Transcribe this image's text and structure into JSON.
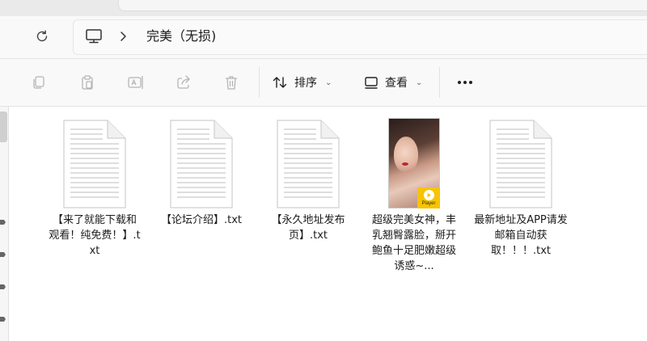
{
  "window": {
    "breadcrumb": {
      "root_icon": "this-pc-icon",
      "separator_icon": "chevron-right-icon",
      "current": "完美（无损)"
    }
  },
  "toolbar": {
    "icons": [
      "copy-icon",
      "paste-icon",
      "rename-icon",
      "share-icon",
      "delete-icon"
    ],
    "sort_label": "排序",
    "view_label": "查看",
    "more_icon": "more-icon"
  },
  "files": [
    {
      "name": "【来了就能下载和观看！纯免费！】.txt",
      "type": "text"
    },
    {
      "name": "【论坛介绍】.txt",
      "type": "text"
    },
    {
      "name": "【永久地址发布页】.txt",
      "type": "text"
    },
    {
      "name": "超级完美女神，丰乳翘臀露脸，掰开鲍鱼十足肥嫩超级诱惑~...",
      "type": "video",
      "badge": "Player"
    },
    {
      "name": "最新地址及APP请发邮箱自动获取！！！.txt",
      "type": "text"
    }
  ]
}
